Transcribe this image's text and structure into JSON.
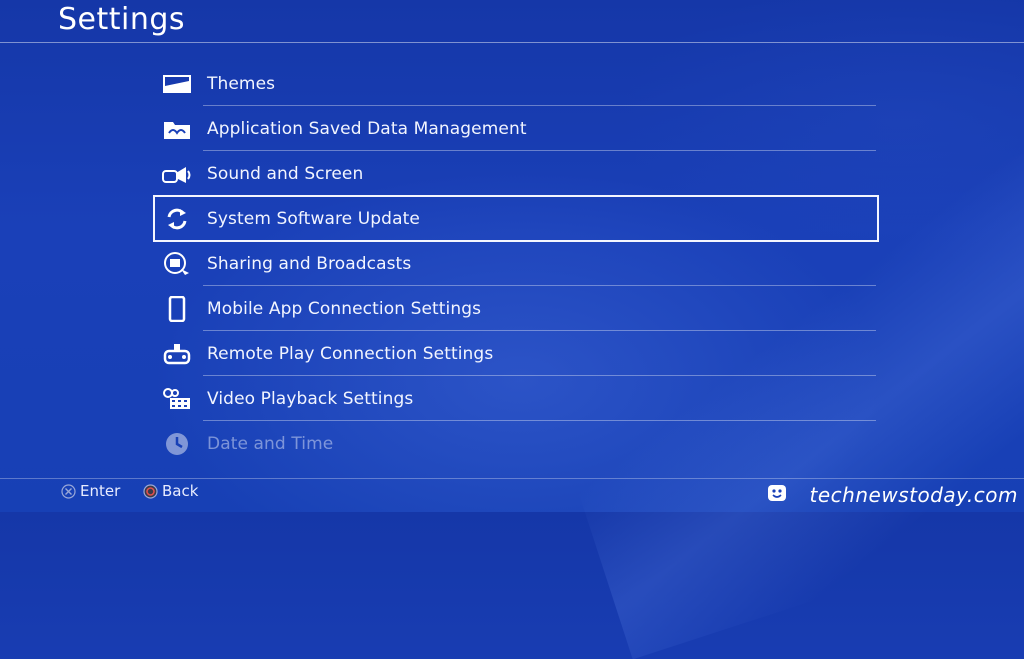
{
  "header": {
    "title": "Settings"
  },
  "menu": {
    "items": [
      {
        "label": "Themes",
        "icon": "themes-icon"
      },
      {
        "label": "Application Saved Data Management",
        "icon": "saved-data-folder-icon"
      },
      {
        "label": "Sound and Screen",
        "icon": "sound-screen-icon"
      },
      {
        "label": "System Software Update",
        "icon": "update-refresh-icon",
        "selected": true
      },
      {
        "label": "Sharing and Broadcasts",
        "icon": "sharing-icon"
      },
      {
        "label": "Mobile App Connection Settings",
        "icon": "mobile-phone-icon"
      },
      {
        "label": "Remote Play Connection Settings",
        "icon": "remote-play-icon"
      },
      {
        "label": "Video Playback Settings",
        "icon": "video-playback-icon"
      },
      {
        "label": "Date and Time",
        "icon": "clock-icon"
      }
    ]
  },
  "footer": {
    "enter_label": "Enter",
    "back_label": "Back",
    "watermark": "technewstoday.com"
  },
  "colors": {
    "background": "#1a40b8",
    "text": "#ffffff",
    "selection_outline": "#f4f6ff"
  }
}
